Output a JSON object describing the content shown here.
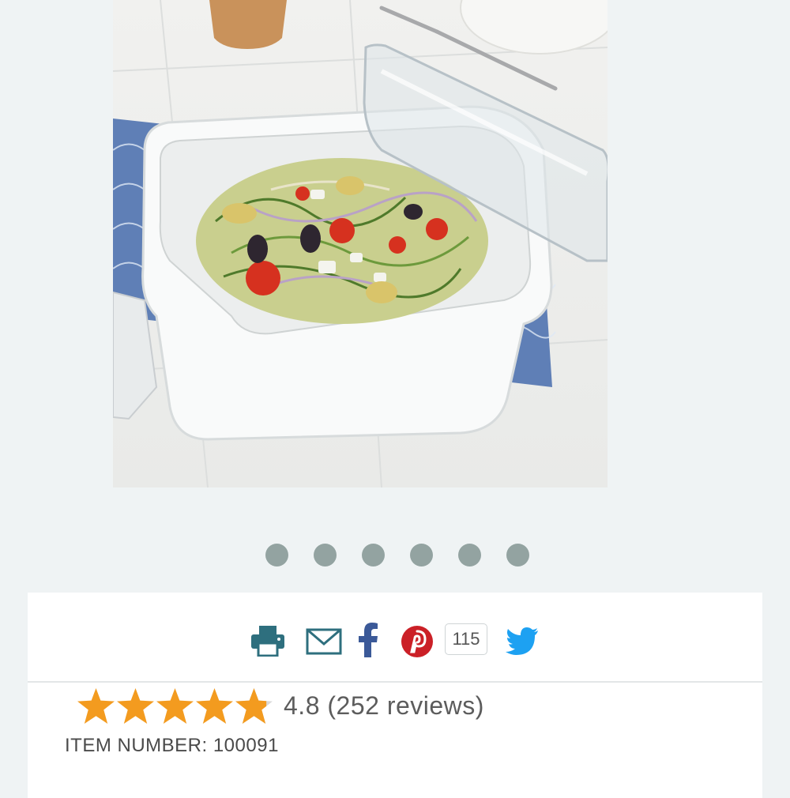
{
  "product": {
    "image_alt": "White square food storage container with clear lid holding spiralized cucumber salad",
    "image_count": 6
  },
  "share": {
    "print_icon": "print-icon",
    "email_icon": "email-icon",
    "facebook_icon": "facebook-icon",
    "pinterest_icon": "pinterest-icon",
    "pinterest_count": "115",
    "twitter_icon": "twitter-icon"
  },
  "rating": {
    "value": 4.8,
    "stars_out_of": 5,
    "text": "4.8 (252 reviews)"
  },
  "item": {
    "number_text": "ITEM NUMBER: 100091"
  },
  "colors": {
    "star": "#f39b1f",
    "share_icon": "#2e6f7e",
    "facebook": "#3b5998",
    "pinterest": "#cb2027",
    "twitter": "#1da1f2",
    "carousel_dot": "#93a3a1"
  }
}
